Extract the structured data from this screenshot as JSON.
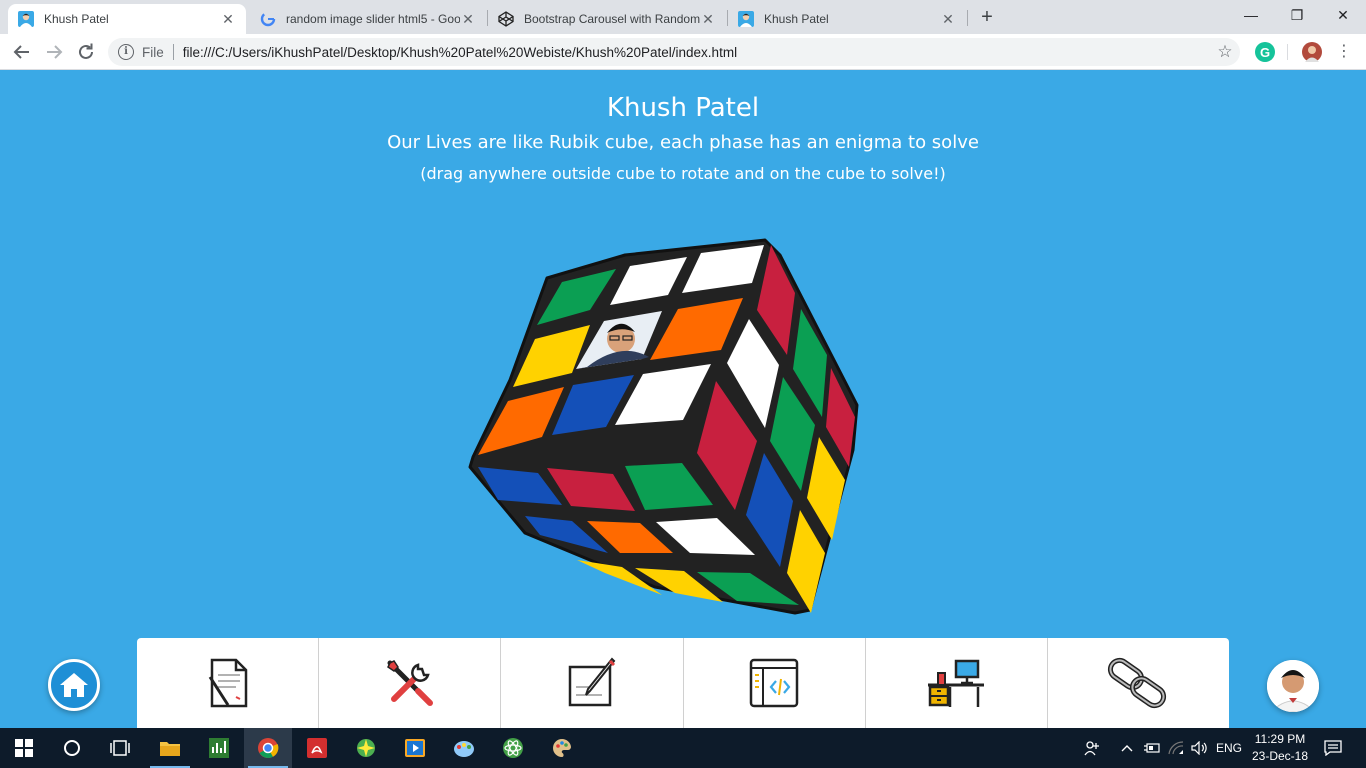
{
  "browser": {
    "tabs": [
      {
        "title": "Khush Patel",
        "active": true
      },
      {
        "title": "random image slider html5 - Goo",
        "active": false
      },
      {
        "title": "Bootstrap Carousel with Random",
        "active": false
      },
      {
        "title": "Khush Patel",
        "active": false
      }
    ],
    "new_tab": "+",
    "window": {
      "minimize": "—",
      "restore": "❐",
      "close": "✕"
    },
    "scheme": "File",
    "url": "file:///C:/Users/iKhushPatel/Desktop/Khush%20Patel%20Webiste/Khush%20Patel/index.html"
  },
  "page": {
    "title": "Khush Patel",
    "subtitle": "Our Lives are like Rubik cube, each phase has an enigma to solve",
    "hint": "(drag anywhere outside cube to rotate and on the cube to solve!)"
  },
  "menu": {
    "items": [
      {
        "icon": "document-icon"
      },
      {
        "icon": "tools-icon"
      },
      {
        "icon": "edit-note-icon"
      },
      {
        "icon": "code-window-icon"
      },
      {
        "icon": "workspace-desk-icon"
      },
      {
        "icon": "link-icon"
      }
    ]
  },
  "taskbar": {
    "language": "ENG",
    "time": "11:29 PM",
    "date": "23-Dec-18"
  },
  "colors": {
    "page_bg": "#3aa9e6",
    "cube_red": "#c8203f",
    "cube_green": "#0b9f53",
    "cube_blue": "#1450b8",
    "cube_orange": "#ff6a00",
    "cube_yellow": "#ffd200",
    "cube_white": "#ffffff"
  }
}
